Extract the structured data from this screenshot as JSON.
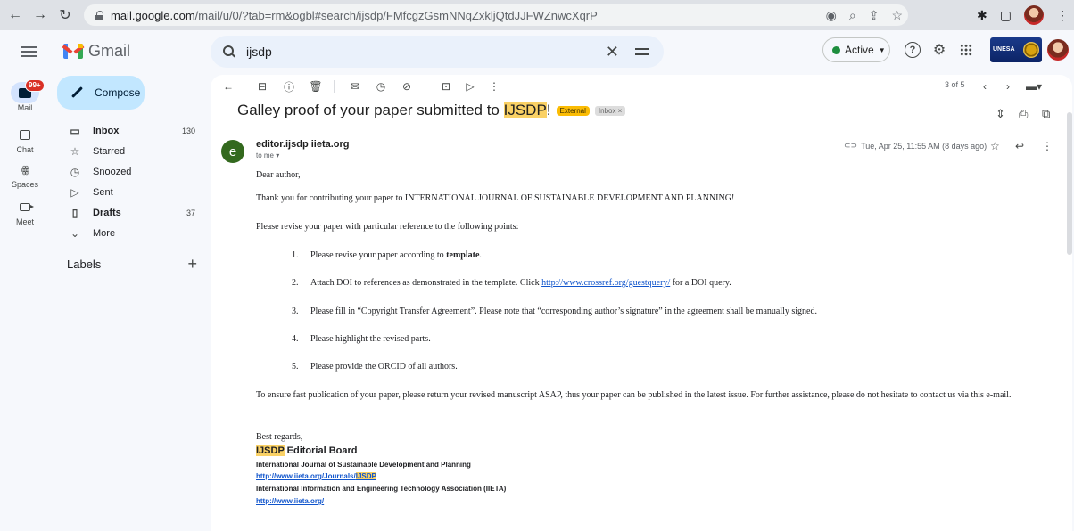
{
  "browser": {
    "url_host": "mail.google.com",
    "url_path": "/mail/u/0/?tab=rm&ogbl#search/ijsdp/FMfcgzGsmNNqZxkljQtdJJFWZnwcXqrP"
  },
  "app": {
    "name": "Gmail",
    "search_query": "ijsdp",
    "status": "Active",
    "org_logo_text": "UNESA"
  },
  "rail": {
    "mail_label": "Mail",
    "mail_badge": "99+",
    "chat_label": "Chat",
    "spaces_label": "Spaces",
    "meet_label": "Meet"
  },
  "sidebar": {
    "compose": "Compose",
    "items": [
      {
        "label": "Inbox",
        "count": "130",
        "icon": "inbox-icon"
      },
      {
        "label": "Starred",
        "count": "",
        "icon": "star-icon"
      },
      {
        "label": "Snoozed",
        "count": "",
        "icon": "clock-icon"
      },
      {
        "label": "Sent",
        "count": "",
        "icon": "send-icon"
      },
      {
        "label": "Drafts",
        "count": "37",
        "icon": "draft-icon"
      },
      {
        "label": "More",
        "count": "",
        "icon": "chevron-down-icon"
      }
    ],
    "labels_heading": "Labels"
  },
  "toolbar": {
    "pager": "3 of 5"
  },
  "email": {
    "subject_pre": "Galley proof of your paper submitted to ",
    "subject_hl": "IJSDP",
    "subject_post": "!",
    "tag_external": "External",
    "tag_inbox": "Inbox ×",
    "sender": "editor.ijsdp iieta.org",
    "to": "to me ▾",
    "date": "Tue, Apr 25, 11:55 AM (8 days ago)",
    "greeting": "Dear author,",
    "intro": "Thank you for contributing your paper to INTERNATIONAL JOURNAL OF SUSTAINABLE DEVELOPMENT AND PLANNING!",
    "lead": "Please revise your paper with particular reference to the following points:",
    "points": [
      {
        "num": "1.",
        "pre": "Please revise your paper according to ",
        "bold": "template",
        "post": "."
      },
      {
        "num": "2.",
        "pre": "Attach DOI to references as demonstrated in the template. Click ",
        "link": "http://www.crossref.org/guestquery/",
        "post": " for a DOI query."
      },
      {
        "num": "3.",
        "text": "Please fill in “Copyright Transfer Agreement”. Please note that “corresponding author’s signature” in the agreement shall be manually signed."
      },
      {
        "num": "4.",
        "text": "Please highlight the revised parts."
      },
      {
        "num": "5.",
        "text": "Please provide the ORCID of all authors."
      }
    ],
    "closing_para": "To ensure fast publication of your paper, please return your revised manuscript ASAP, thus your paper can be published in the latest issue.  For further assistance, please do not hesitate to contact us via this e-mail.",
    "regards": "Best regards,",
    "sig_hl": "IJSDP",
    "sig_title": " Editorial Board",
    "sig_journal": "International Journal of Sustainable Development and Planning",
    "sig_link1_pre": "http://www.iieta.org/Journals/",
    "sig_link1_hl": "IJSDP",
    "sig_assoc": "International Information and Engineering Technology Association (IIETA)",
    "sig_link2": "http://www.iieta.org/"
  }
}
